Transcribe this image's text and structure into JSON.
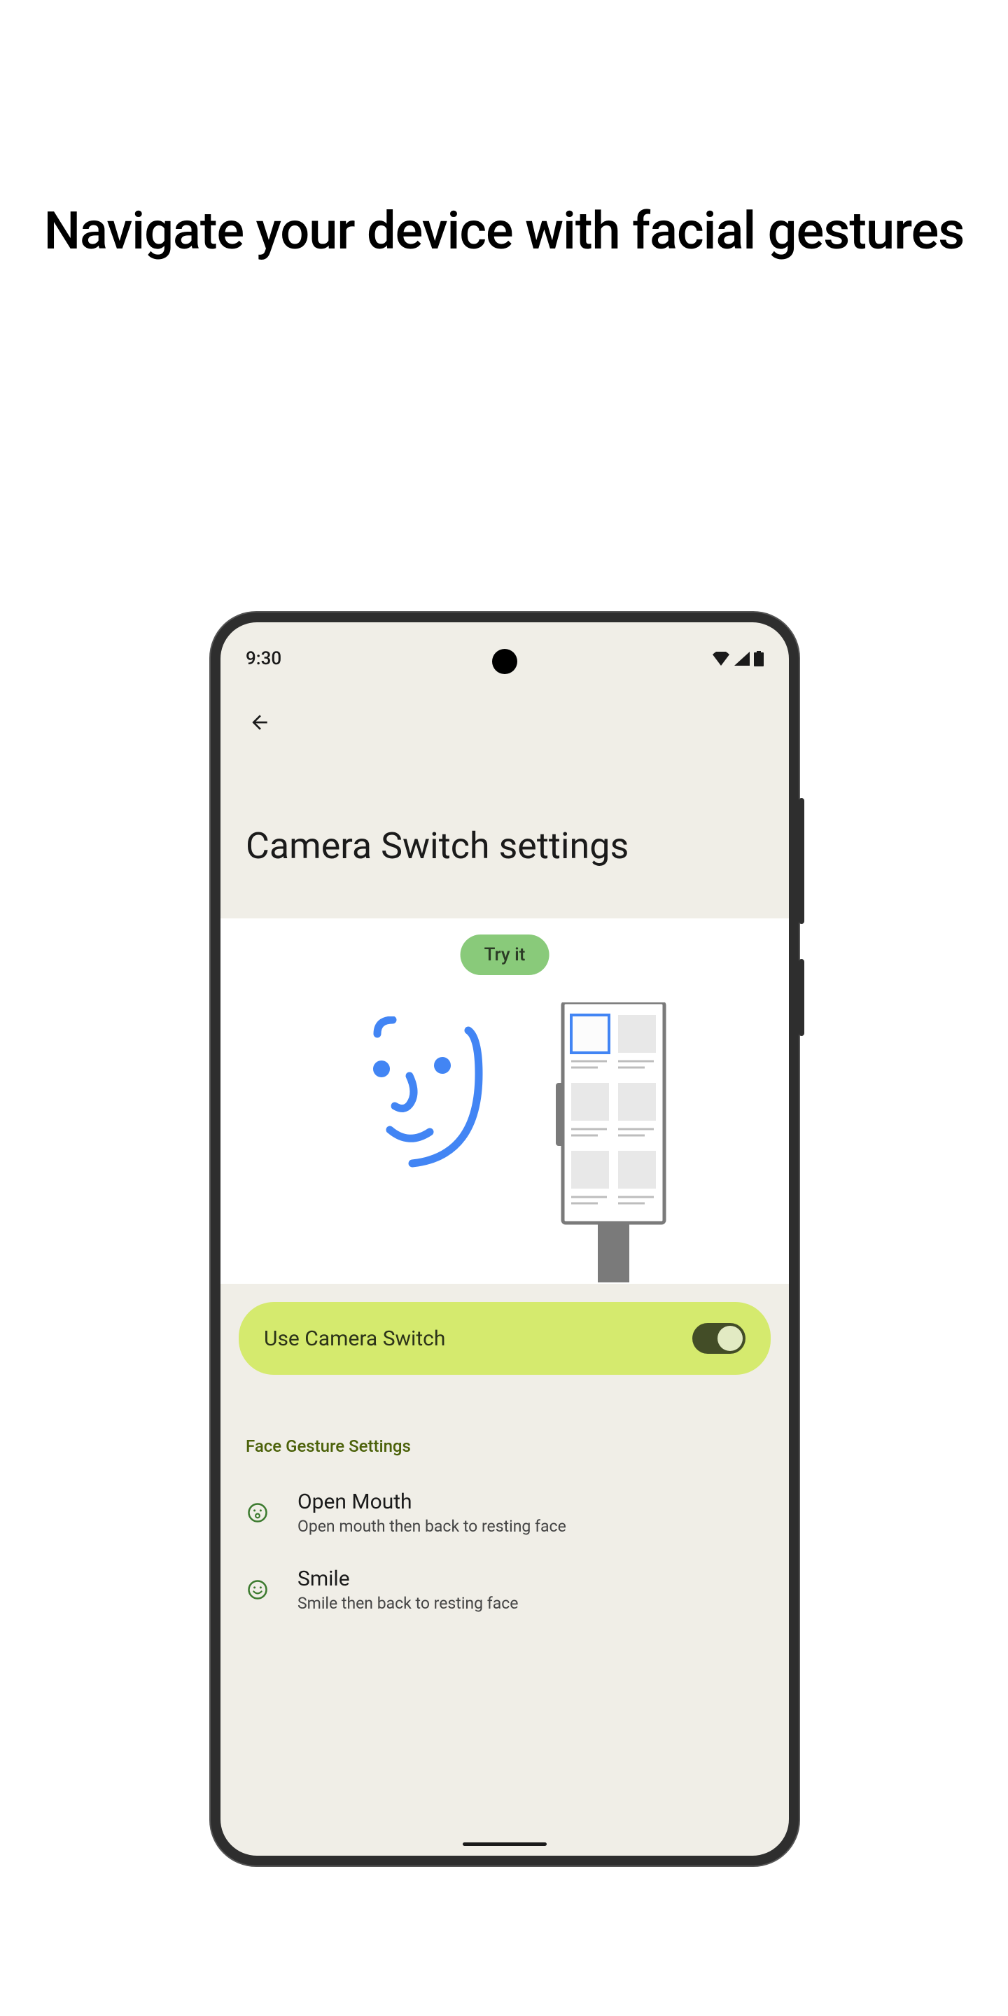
{
  "promo": {
    "heading": "Navigate your device with facial gestures"
  },
  "status_bar": {
    "time": "9:30"
  },
  "page": {
    "title": "Camera Switch settings"
  },
  "hero": {
    "try_it_label": "Try it"
  },
  "toggle": {
    "label": "Use Camera Switch",
    "on": true
  },
  "section": {
    "header": "Face Gesture Settings"
  },
  "gestures": [
    {
      "title": "Open Mouth",
      "desc": "Open mouth then back to resting face",
      "icon": "open-mouth"
    },
    {
      "title": "Smile",
      "desc": "Smile then back to resting face",
      "icon": "smile"
    }
  ]
}
